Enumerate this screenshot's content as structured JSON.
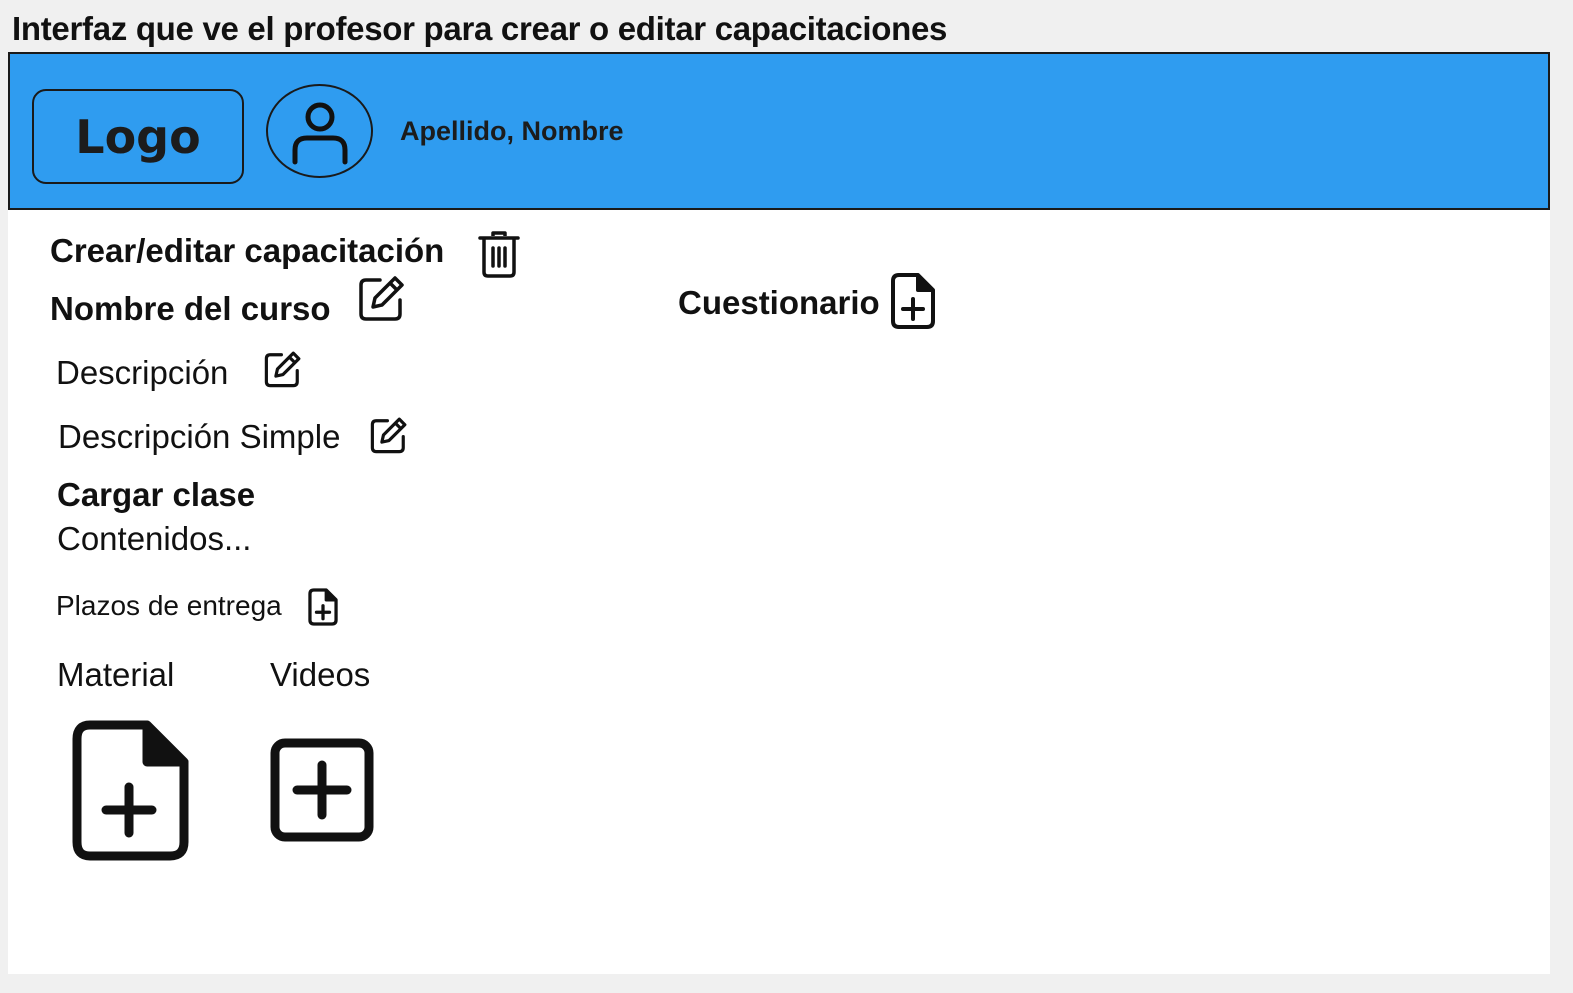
{
  "caption": "Interfaz que ve el profesor para crear o editar capacitaciones",
  "header": {
    "logo_label": "Logo",
    "avatar_icon": "user-icon",
    "user_name": "Apellido, Nombre",
    "background_color": "#2f9cf0"
  },
  "form": {
    "title": "Crear/editar capacitación",
    "delete_icon": "trash-icon",
    "course_name": "Nombre del curso",
    "description": "Descripción",
    "simple_description": "Descripción Simple",
    "load_class": "Cargar clase",
    "contents": "Contenidos...",
    "deadlines": "Plazos de entrega",
    "material_label": "Material",
    "videos_label": "Videos",
    "edit_icon": "pencil-square-icon",
    "file_add_icon": "file-plus-icon",
    "square_add_icon": "square-plus-icon"
  },
  "quiz": {
    "label": "Cuestionario"
  }
}
